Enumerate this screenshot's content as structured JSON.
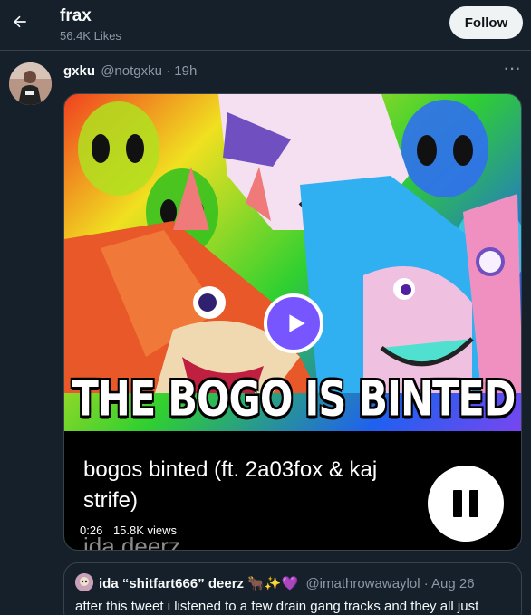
{
  "header": {
    "title": "frax",
    "subtitle": "56.4K Likes",
    "back_icon": "arrow-left-icon",
    "follow_label": "Follow"
  },
  "tweet": {
    "author_name": "gxku",
    "author_meta": "@notgxku · 19h",
    "more_icon": "more-icon",
    "more_label": "···",
    "media": {
      "banner_text": "THE BOGO IS BINTED",
      "caption": "bogos binted (ft. 2a03fox & kaj strife)",
      "watermark": "ida deerz",
      "time": "0:26",
      "views": "15.8K views",
      "play_icon": "play-icon",
      "pause_icon": "pause-icon"
    }
  },
  "quote": {
    "author_name": "ida “shitfart666” deerz 🐂✨💜",
    "author_meta": "@imathrowawaylol · Aug 26",
    "text": "after this tweet i listened to a few drain gang tracks and they all just"
  },
  "colors": {
    "background": "#15202b",
    "border": "#38444d",
    "secondary_text": "#8b98a5",
    "play_button": "#7856ff"
  }
}
